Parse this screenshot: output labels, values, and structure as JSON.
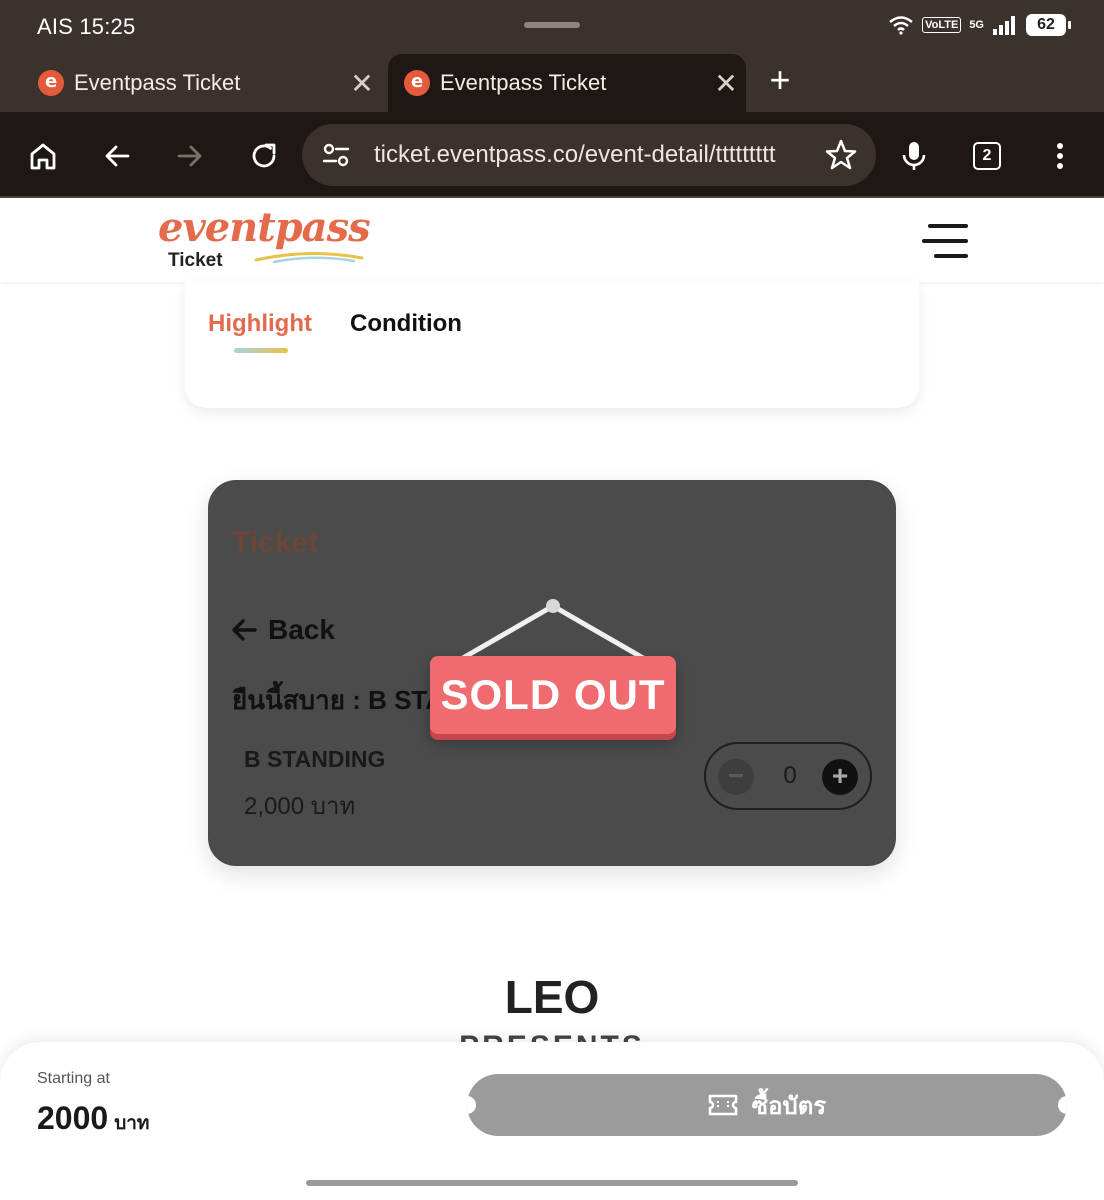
{
  "status_bar": {
    "carrier_time": "AIS 15:25",
    "volte": "VoLTE",
    "network": "5G",
    "battery": "62"
  },
  "tabs": [
    {
      "title": "Eventpass Ticket",
      "close": "✕"
    },
    {
      "title": "Eventpass Ticket",
      "close": "✕"
    }
  ],
  "new_tab": "+",
  "toolbar": {
    "url": "ticket.eventpass.co/event-detail/ttttttttt",
    "tab_count": "2"
  },
  "site": {
    "logo_word": "eventpass",
    "logo_sub": "Ticket",
    "brand_color": "#e46a4c"
  },
  "section_tabs": {
    "highlight": "Highlight",
    "condition": "Condition"
  },
  "ticket_panel": {
    "title": "Ticket",
    "back": "Back",
    "zone": "ยืนนี้สบาย : B STANDING",
    "type": "B STANDING",
    "price": "2,000  บาท",
    "quantity": "0",
    "minus": "−",
    "plus": "+",
    "sold_out": "SOLD OUT"
  },
  "event": {
    "name": "LEO",
    "sub": "PRESENTS"
  },
  "purchase": {
    "starting_label": "Starting at",
    "starting_price": "2000",
    "unit": "บาท",
    "buy_label": "ซื้อบัตร"
  }
}
